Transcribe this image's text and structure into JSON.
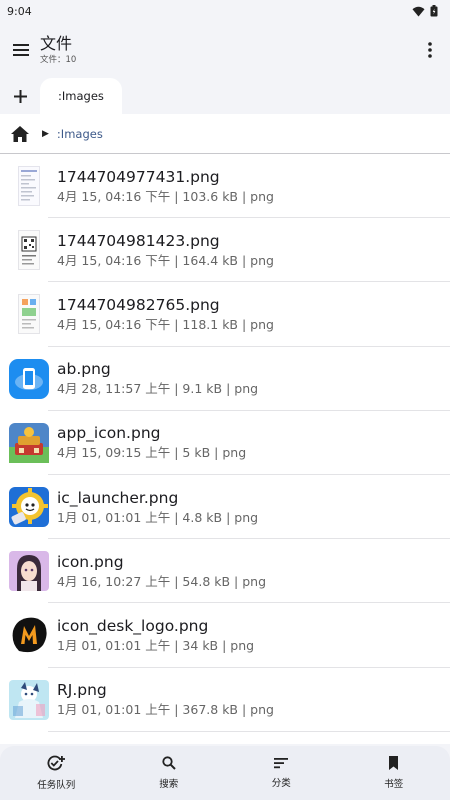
{
  "status": {
    "time": "9:04"
  },
  "app_bar": {
    "title": "文件",
    "subtitle": "文件：10"
  },
  "tabs": [
    {
      "label": ":Images"
    }
  ],
  "breadcrumb": {
    "arrow": "▶",
    "path": ":Images"
  },
  "files": [
    {
      "name": "1744704977431.png",
      "meta": "4月 15, 04:16 下午 | 103.6 kB | png",
      "icon": "screenshot-thumbnail"
    },
    {
      "name": "1744704981423.png",
      "meta": "4月 15, 04:16 下午 | 164.4 kB | png",
      "icon": "qr-screenshot-thumbnail"
    },
    {
      "name": "1744704982765.png",
      "meta": "4月 15, 04:16 下午 | 118.1 kB | png",
      "icon": "screenshot-thumbnail"
    },
    {
      "name": "ab.png",
      "meta": "4月 28, 11:57 上午 | 9.1 kB | png",
      "icon": "blue-phone-icon"
    },
    {
      "name": "app_icon.png",
      "meta": "4月 15, 09:15 上午 | 5 kB | png",
      "icon": "game-app-icon"
    },
    {
      "name": "ic_launcher.png",
      "meta": "1月 01, 01:01 上午 | 4.8 kB | png",
      "icon": "launcher-gear-icon"
    },
    {
      "name": "icon.png",
      "meta": "4月 16, 10:27 上午 | 54.8 kB | png",
      "icon": "anime-girl-icon"
    },
    {
      "name": "icon_desk_logo.png",
      "meta": "1月 01, 01:01 上午 | 34 kB | png",
      "icon": "m-logo-icon"
    },
    {
      "name": "RJ.png",
      "meta": "1月 01, 01:01 上午 | 367.8 kB | png",
      "icon": "anime-art-icon"
    }
  ],
  "bottom_nav": [
    {
      "label": "任务队列",
      "icon": "task-queue-icon"
    },
    {
      "label": "搜索",
      "icon": "search-icon"
    },
    {
      "label": "分类",
      "icon": "sort-icon"
    },
    {
      "label": "书签",
      "icon": "bookmark-icon"
    }
  ],
  "colors": {
    "background": "#f3f4f8",
    "surface": "#ffffff",
    "accent": "#3e5a8a",
    "bottom_nav": "#eceef4"
  }
}
